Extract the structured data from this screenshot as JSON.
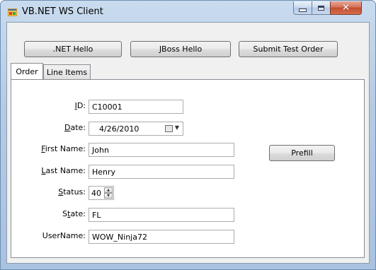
{
  "window": {
    "title": "VB.NET WS Client",
    "close_glyph": "✕"
  },
  "toolbar": {
    "net_hello_label": ".NET Hello",
    "jboss_hello_label": "JBoss Hello",
    "submit_order_label": "Submit Test Order"
  },
  "tabs": [
    {
      "label": "Order",
      "active": true
    },
    {
      "label": "Line Items",
      "active": false
    }
  ],
  "order_form": {
    "id": {
      "label_pre": "",
      "mnemonic": "I",
      "label_post": "D:",
      "value": "C10001"
    },
    "date": {
      "label_pre": "",
      "mnemonic": "D",
      "label_post": "ate:",
      "value": "4/26/2010"
    },
    "first_name": {
      "label_pre": "",
      "mnemonic": "F",
      "label_post": "irst Name:",
      "value": "John"
    },
    "last_name": {
      "label_pre": "",
      "mnemonic": "L",
      "label_post": "ast Name:",
      "value": "Henry"
    },
    "status": {
      "label_pre": "",
      "mnemonic": "S",
      "label_post": "tatus:",
      "value": "40"
    },
    "state": {
      "label_pre": "S",
      "mnemonic": "t",
      "label_post": "ate:",
      "value": "FL"
    },
    "username": {
      "label": "UserName:",
      "value": "WOW_Ninja72"
    },
    "prefill_label": "Prefill"
  },
  "icons": {
    "app": "app-window-icon",
    "calendar": "calendar-icon",
    "dropdown": "chevron-down-icon"
  },
  "colors": {
    "titlebar": "#b4cbe4",
    "close_button": "#c24d2e",
    "client_bg": "#f0f0f0"
  }
}
